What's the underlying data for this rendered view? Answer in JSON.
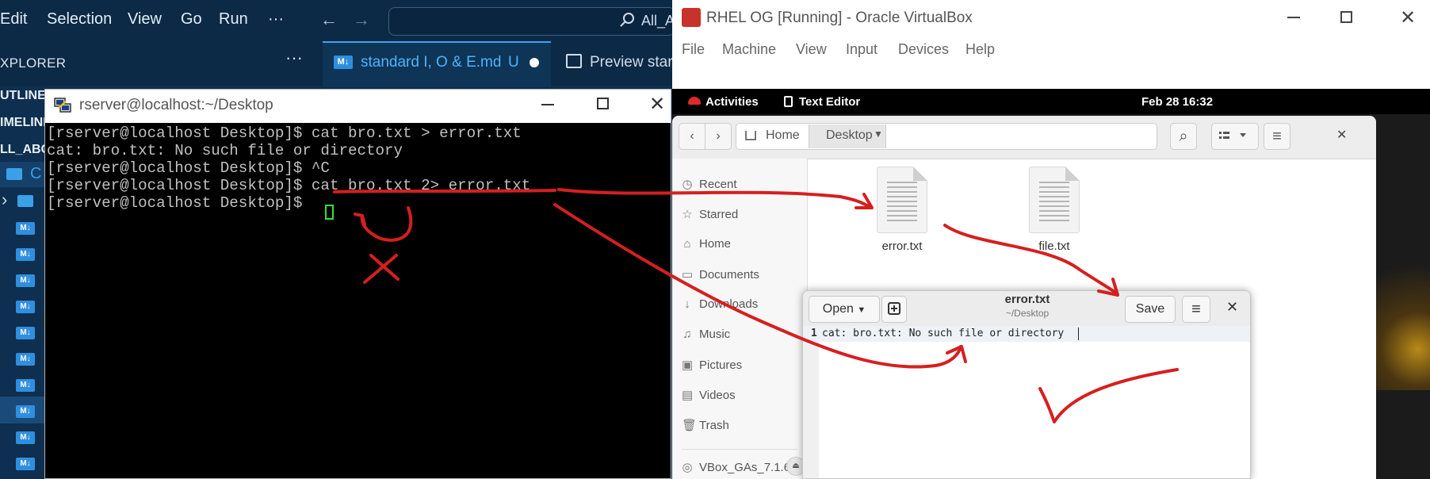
{
  "vscode": {
    "menu": [
      "Edit",
      "Selection",
      "View",
      "Go",
      "Run",
      "···"
    ],
    "nav_back": "←",
    "nav_forward": "→",
    "search_text": "All_A",
    "explorer_title": "XPLORER",
    "explorer_more": "···",
    "active_tab": {
      "icon": "M↓",
      "label": "standard I, O & E.md",
      "status": "U"
    },
    "second_tab": {
      "label": "Preview star"
    },
    "sidebar_sections": [
      "UTLINE",
      "IMELINE",
      "LL_ABO"
    ],
    "folder_label": "C",
    "tree_chevron": "›",
    "md_icon": "M↓"
  },
  "terminal": {
    "title": "rserver@localhost:~/Desktop",
    "lines": [
      "[rserver@localhost Desktop]$ cat bro.txt > error.txt",
      "cat: bro.txt: No such file or directory",
      "[rserver@localhost Desktop]$ ^C",
      "[rserver@localhost Desktop]$ cat bro.txt 2> error.txt",
      "[rserver@localhost Desktop]$ "
    ],
    "close": "✕"
  },
  "vbox": {
    "title": "RHEL OG [Running] - Oracle VirtualBox",
    "menu": [
      "File",
      "Machine",
      "View",
      "Input",
      "Devices",
      "Help"
    ],
    "close": "✕"
  },
  "gnome": {
    "activities": "Activities",
    "app_name": "Text Editor",
    "clock": "Feb 28  16:32"
  },
  "files": {
    "back": "‹",
    "forward": "›",
    "path": [
      "Home",
      "Desktop"
    ],
    "search_icon": "⌕",
    "menu_icon": "≡",
    "close": "✕",
    "sidebar": [
      {
        "icon": "clock-icon",
        "glyph": "◷",
        "label": "Recent"
      },
      {
        "icon": "star-icon",
        "glyph": "☆",
        "label": "Starred"
      },
      {
        "icon": "home-icon",
        "glyph": "⌂",
        "label": "Home"
      },
      {
        "icon": "documents-icon",
        "glyph": "▭",
        "label": "Documents"
      },
      {
        "icon": "downloads-icon",
        "glyph": "↓",
        "label": "Downloads"
      },
      {
        "icon": "music-icon",
        "glyph": "♫",
        "label": "Music"
      },
      {
        "icon": "pictures-icon",
        "glyph": "▣",
        "label": "Pictures"
      },
      {
        "icon": "videos-icon",
        "glyph": "▤",
        "label": "Videos"
      },
      {
        "icon": "trash-icon",
        "glyph": "🗑",
        "label": "Trash"
      },
      {
        "icon": "disc-icon",
        "glyph": "◎",
        "label": "VBox_GAs_7.1.6"
      }
    ],
    "eject": "⏏",
    "items": [
      "error.txt",
      "file.txt"
    ]
  },
  "gedit": {
    "open_label": "Open",
    "save_label": "Save",
    "title": "error.txt",
    "subtitle": "~/Desktop",
    "close": "✕",
    "line_number": "1",
    "content": "cat: bro.txt: No such file or directory"
  },
  "annotations": {
    "color": "#d61f1f"
  }
}
